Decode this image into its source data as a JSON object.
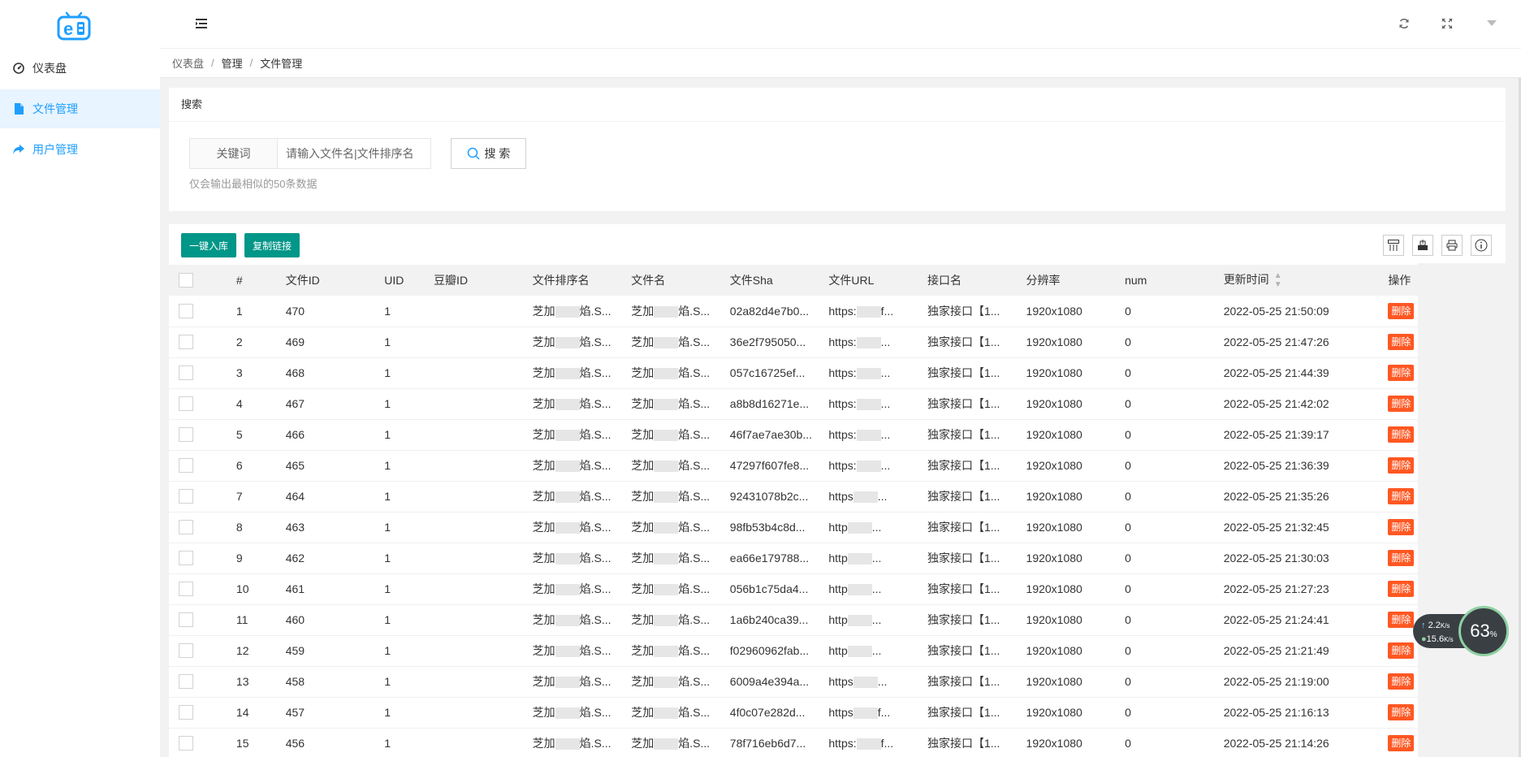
{
  "sidebar": {
    "items": [
      {
        "label": "仪表盘",
        "icon": "dashboard-icon"
      },
      {
        "label": "文件管理",
        "icon": "file-icon"
      },
      {
        "label": "用户管理",
        "icon": "share-arrow-icon"
      }
    ]
  },
  "breadcrumb": {
    "items": [
      "仪表盘",
      "管理",
      "文件管理"
    ]
  },
  "search": {
    "title": "搜索",
    "field_label": "关键词",
    "placeholder": "请输入文件名|文件排序名",
    "button_label": "搜 索",
    "hint": "仅会输出最相似的50条数据"
  },
  "toolbar": {
    "import_label": "一键入库",
    "copy_label": "复制链接"
  },
  "table": {
    "columns": [
      "#",
      "文件ID",
      "UID",
      "豆瓣ID",
      "文件排序名",
      "文件名",
      "文件Sha",
      "文件URL",
      "接口名",
      "分辨率",
      "num",
      "更新时间",
      "操作"
    ],
    "delete_label": "删除",
    "rows": [
      {
        "n": "1",
        "id": "470",
        "uid": "1",
        "douban": "",
        "sort": "芝加",
        "sort_tail": "焰.S...",
        "name": "芝加",
        "name_tail": "焰.S...",
        "sha": "02a82d4e7b0...",
        "url": "https:",
        "url_tail": "f...",
        "api": "独家接口【1...",
        "res": "1920x1080",
        "num": "0",
        "time": "2022-05-25 21:50:09"
      },
      {
        "n": "2",
        "id": "469",
        "uid": "1",
        "douban": "",
        "sort": "芝加",
        "sort_tail": "焰.S...",
        "name": "芝加",
        "name_tail": "焰.S...",
        "sha": "36e2f795050...",
        "url": "https:",
        "url_tail": "...",
        "api": "独家接口【1...",
        "res": "1920x1080",
        "num": "0",
        "time": "2022-05-25 21:47:26"
      },
      {
        "n": "3",
        "id": "468",
        "uid": "1",
        "douban": "",
        "sort": "芝加",
        "sort_tail": "焰.S...",
        "name": "芝加",
        "name_tail": "焰.S...",
        "sha": "057c16725ef...",
        "url": "https:",
        "url_tail": "...",
        "api": "独家接口【1...",
        "res": "1920x1080",
        "num": "0",
        "time": "2022-05-25 21:44:39"
      },
      {
        "n": "4",
        "id": "467",
        "uid": "1",
        "douban": "",
        "sort": "芝加",
        "sort_tail": "焰.S...",
        "name": "芝加",
        "name_tail": "焰.S...",
        "sha": "a8b8d16271e...",
        "url": "https:",
        "url_tail": "...",
        "api": "独家接口【1...",
        "res": "1920x1080",
        "num": "0",
        "time": "2022-05-25 21:42:02"
      },
      {
        "n": "5",
        "id": "466",
        "uid": "1",
        "douban": "",
        "sort": "芝加",
        "sort_tail": "焰.S...",
        "name": "芝加",
        "name_tail": "焰.S...",
        "sha": "46f7ae7ae30b...",
        "url": "https:",
        "url_tail": "...",
        "api": "独家接口【1...",
        "res": "1920x1080",
        "num": "0",
        "time": "2022-05-25 21:39:17"
      },
      {
        "n": "6",
        "id": "465",
        "uid": "1",
        "douban": "",
        "sort": "芝加",
        "sort_tail": "焰.S...",
        "name": "芝加",
        "name_tail": "焰.S...",
        "sha": "47297f607fe8...",
        "url": "https:",
        "url_tail": "...",
        "api": "独家接口【1...",
        "res": "1920x1080",
        "num": "0",
        "time": "2022-05-25 21:36:39"
      },
      {
        "n": "7",
        "id": "464",
        "uid": "1",
        "douban": "",
        "sort": "芝加",
        "sort_tail": "焰.S...",
        "name": "芝加",
        "name_tail": "焰.S...",
        "sha": "92431078b2c...",
        "url": "https",
        "url_tail": "...",
        "api": "独家接口【1...",
        "res": "1920x1080",
        "num": "0",
        "time": "2022-05-25 21:35:26"
      },
      {
        "n": "8",
        "id": "463",
        "uid": "1",
        "douban": "",
        "sort": "芝加",
        "sort_tail": "焰.S...",
        "name": "芝加",
        "name_tail": "焰.S...",
        "sha": "98fb53b4c8d...",
        "url": "http",
        "url_tail": "...",
        "api": "独家接口【1...",
        "res": "1920x1080",
        "num": "0",
        "time": "2022-05-25 21:32:45"
      },
      {
        "n": "9",
        "id": "462",
        "uid": "1",
        "douban": "",
        "sort": "芝加",
        "sort_tail": "焰.S...",
        "name": "芝加",
        "name_tail": "焰.S...",
        "sha": "ea66e179788...",
        "url": "http",
        "url_tail": "...",
        "api": "独家接口【1...",
        "res": "1920x1080",
        "num": "0",
        "time": "2022-05-25 21:30:03"
      },
      {
        "n": "10",
        "id": "461",
        "uid": "1",
        "douban": "",
        "sort": "芝加",
        "sort_tail": "焰.S...",
        "name": "芝加",
        "name_tail": "焰.S...",
        "sha": "056b1c75da4...",
        "url": "http",
        "url_tail": "...",
        "api": "独家接口【1...",
        "res": "1920x1080",
        "num": "0",
        "time": "2022-05-25 21:27:23"
      },
      {
        "n": "11",
        "id": "460",
        "uid": "1",
        "douban": "",
        "sort": "芝加",
        "sort_tail": "焰.S...",
        "name": "芝加",
        "name_tail": "焰.S...",
        "sha": "1a6b240ca39...",
        "url": "http",
        "url_tail": "...",
        "api": "独家接口【1...",
        "res": "1920x1080",
        "num": "0",
        "time": "2022-05-25 21:24:41"
      },
      {
        "n": "12",
        "id": "459",
        "uid": "1",
        "douban": "",
        "sort": "芝加",
        "sort_tail": "焰.S...",
        "name": "芝加",
        "name_tail": "焰.S...",
        "sha": "f02960962fab...",
        "url": "http",
        "url_tail": "...",
        "api": "独家接口【1...",
        "res": "1920x1080",
        "num": "0",
        "time": "2022-05-25 21:21:49"
      },
      {
        "n": "13",
        "id": "458",
        "uid": "1",
        "douban": "",
        "sort": "芝加",
        "sort_tail": "焰.S...",
        "name": "芝加",
        "name_tail": "焰.S...",
        "sha": "6009a4e394a...",
        "url": "https",
        "url_tail": "...",
        "api": "独家接口【1...",
        "res": "1920x1080",
        "num": "0",
        "time": "2022-05-25 21:19:00"
      },
      {
        "n": "14",
        "id": "457",
        "uid": "1",
        "douban": "",
        "sort": "芝加",
        "sort_tail": "焰.S...",
        "name": "芝加",
        "name_tail": "焰.S...",
        "sha": "4f0c07e282d...",
        "url": "https",
        "url_tail": "f...",
        "api": "独家接口【1...",
        "res": "1920x1080",
        "num": "0",
        "time": "2022-05-25 21:16:13"
      },
      {
        "n": "15",
        "id": "456",
        "uid": "1",
        "douban": "",
        "sort": "芝加",
        "sort_tail": "焰.S...",
        "name": "芝加",
        "name_tail": "焰.S...",
        "sha": "78f716eb6d7...",
        "url": "https:",
        "url_tail": "f...",
        "api": "独家接口【1...",
        "res": "1920x1080",
        "num": "0",
        "time": "2022-05-25 21:14:26"
      }
    ]
  },
  "net_widget": {
    "up": "2.2",
    "down": "15.6",
    "unit": "K/s",
    "percent": "63",
    "percent_sign": "%"
  },
  "colors": {
    "accent": "#1e9fff",
    "green": "#009688",
    "danger": "#ff5722"
  }
}
